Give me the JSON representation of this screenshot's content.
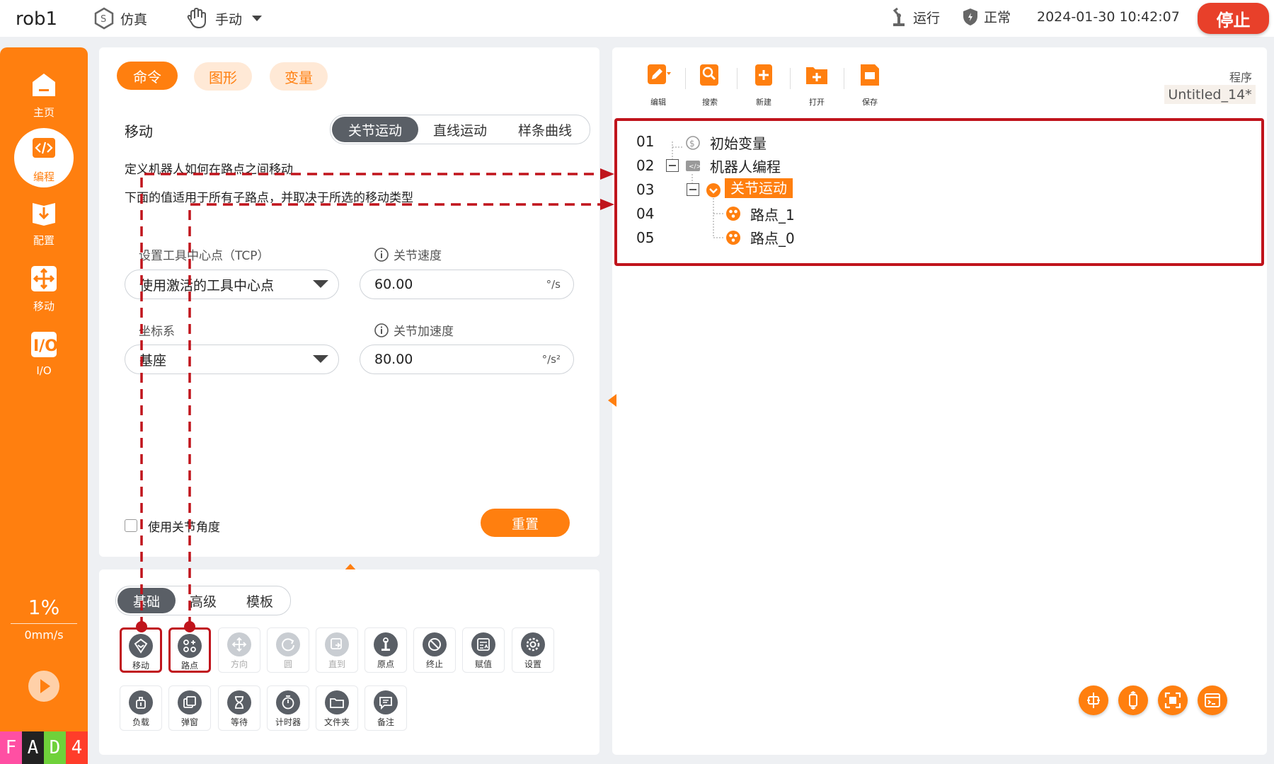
{
  "topbar": {
    "app_name": "rob1",
    "mode_sim": "仿真",
    "mode_manual": "手动",
    "run_state": "运行",
    "health": "正常",
    "datetime": "2024-01-30 10:42:07",
    "stop_label": "停止"
  },
  "sidebar": {
    "items": [
      {
        "label": "主页",
        "icon": "home-icon"
      },
      {
        "label": "编程",
        "icon": "code-icon"
      },
      {
        "label": "配置",
        "icon": "config-icon"
      },
      {
        "label": "移动",
        "icon": "move-icon"
      },
      {
        "label": "I/O",
        "icon": "io-icon"
      }
    ],
    "speed_percent": "1%",
    "speed_mms": "0mm/s",
    "badge": [
      "F",
      "A",
      "D",
      "4"
    ]
  },
  "command_panel": {
    "tabs": [
      "命令",
      "图形",
      "变量"
    ],
    "section_title": "移动",
    "motion_types": [
      "关节运动",
      "直线运动",
      "样条曲线"
    ],
    "desc_1": "定义机器人如何在路点之间移动",
    "desc_2": "下面的值适用于所有子路点，并取决于所选的移动类型",
    "tcp_label": "设置工具中心点（TCP）",
    "tcp_value": "使用激活的工具中心点",
    "coord_label": "坐标系",
    "coord_value": "基座",
    "joint_speed_label": "关节速度",
    "joint_speed_value": "60.00",
    "joint_speed_unit": "°/s",
    "joint_accel_label": "关节加速度",
    "joint_accel_value": "80.00",
    "joint_accel_unit": "°/s²",
    "use_joint_angle": "使用关节角度",
    "reset_label": "重置"
  },
  "toolbox": {
    "tabs": [
      "基础",
      "高级",
      "模板"
    ],
    "row1": [
      {
        "label": "移动",
        "icon": "move-node-icon",
        "enabled": true
      },
      {
        "label": "路点",
        "icon": "waypoint-icon",
        "enabled": true
      },
      {
        "label": "方向",
        "icon": "direction-icon",
        "enabled": false
      },
      {
        "label": "圆",
        "icon": "circle-icon",
        "enabled": false
      },
      {
        "label": "直到",
        "icon": "until-icon",
        "enabled": false
      },
      {
        "label": "原点",
        "icon": "origin-icon",
        "enabled": true
      },
      {
        "label": "终止",
        "icon": "halt-icon",
        "enabled": true
      },
      {
        "label": "赋值",
        "icon": "assign-icon",
        "enabled": true
      },
      {
        "label": "设置",
        "icon": "settings-icon",
        "enabled": true
      }
    ],
    "row2": [
      {
        "label": "负载",
        "icon": "payload-icon",
        "enabled": true
      },
      {
        "label": "弹窗",
        "icon": "popup-icon",
        "enabled": true
      },
      {
        "label": "等待",
        "icon": "hourglass-icon",
        "enabled": true
      },
      {
        "label": "计时器",
        "icon": "timer-icon",
        "enabled": true
      },
      {
        "label": "文件夹",
        "icon": "folder-icon",
        "enabled": true
      },
      {
        "label": "备注",
        "icon": "comment-icon",
        "enabled": true
      }
    ]
  },
  "program_panel": {
    "toolbar": [
      "编辑",
      "搜索",
      "新建",
      "打开",
      "保存"
    ],
    "program_label": "程序",
    "program_name": "Untitled_14*",
    "tree": [
      {
        "num": "01",
        "text": "初始变量"
      },
      {
        "num": "02",
        "text": "机器人编程"
      },
      {
        "num": "03",
        "text": "关节运动"
      },
      {
        "num": "04",
        "text": "路点_1"
      },
      {
        "num": "05",
        "text": "路点_0"
      }
    ]
  },
  "colors": {
    "accent": "#ff7f0f",
    "highlight_red": "#c0141c",
    "stop_red": "#e8402a",
    "dark_icon": "#5a5f66"
  }
}
